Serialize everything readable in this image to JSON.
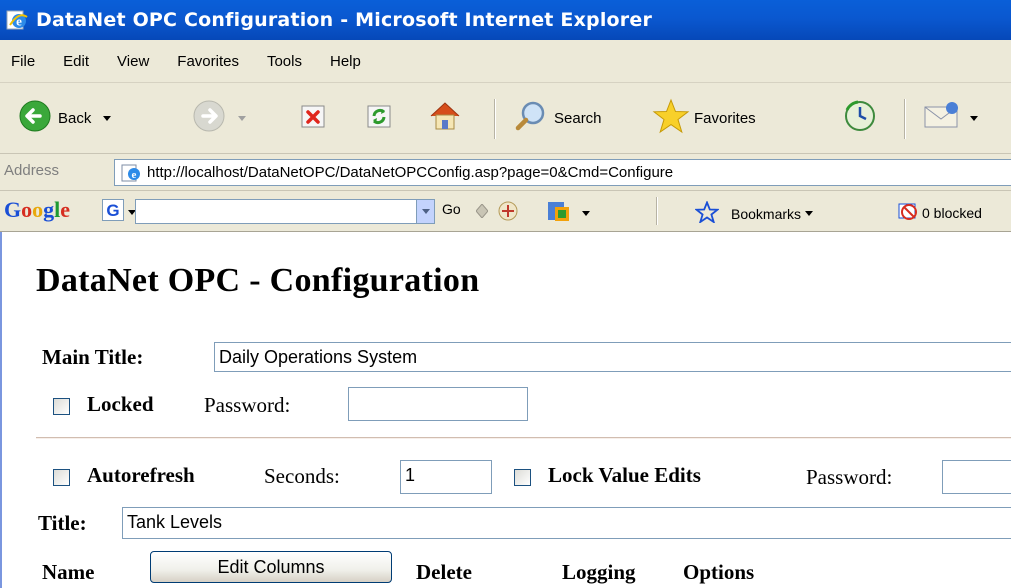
{
  "window": {
    "title": "DataNet OPC Configuration - Microsoft Internet Explorer"
  },
  "menu": {
    "items": [
      "File",
      "Edit",
      "View",
      "Favorites",
      "Tools",
      "Help"
    ]
  },
  "toolbar": {
    "back_label": "Back",
    "search_label": "Search",
    "favorites_label": "Favorites"
  },
  "address": {
    "label": "Address",
    "url": "http://localhost/DataNetOPC/DataNetOPCConfig.asp?page=0&Cmd=Configure"
  },
  "google": {
    "logo_letters": [
      "G",
      "o",
      "o",
      "g",
      "l",
      "e"
    ],
    "logo_colors": [
      "#1a4fd6",
      "#d62d20",
      "#e8a80c",
      "#1a4fd6",
      "#1e9a32",
      "#d62d20"
    ],
    "search_value": "",
    "go_label": "Go",
    "bookmarks_label": "Bookmarks",
    "blocked_label": "0 blocked"
  },
  "page": {
    "heading": "DataNet OPC - Configuration",
    "main_title_label": "Main Title:",
    "main_title_value": "Daily Operations System",
    "locked_label": "Locked",
    "locked_checked": false,
    "password_label": "Password:",
    "password_value": "",
    "autorefresh_label": "Autorefresh",
    "autorefresh_checked": false,
    "seconds_label": "Seconds:",
    "seconds_value": "1",
    "lock_value_edits_label": "Lock Value Edits",
    "lock_value_edits_checked": false,
    "password2_label": "Password:",
    "password2_value": "",
    "title_label": "Title:",
    "title_value": "Tank Levels",
    "name_header": "Name",
    "edit_columns_label": "Edit Columns",
    "delete_header": "Delete",
    "logging_header": "Logging",
    "options_header": "Options"
  }
}
